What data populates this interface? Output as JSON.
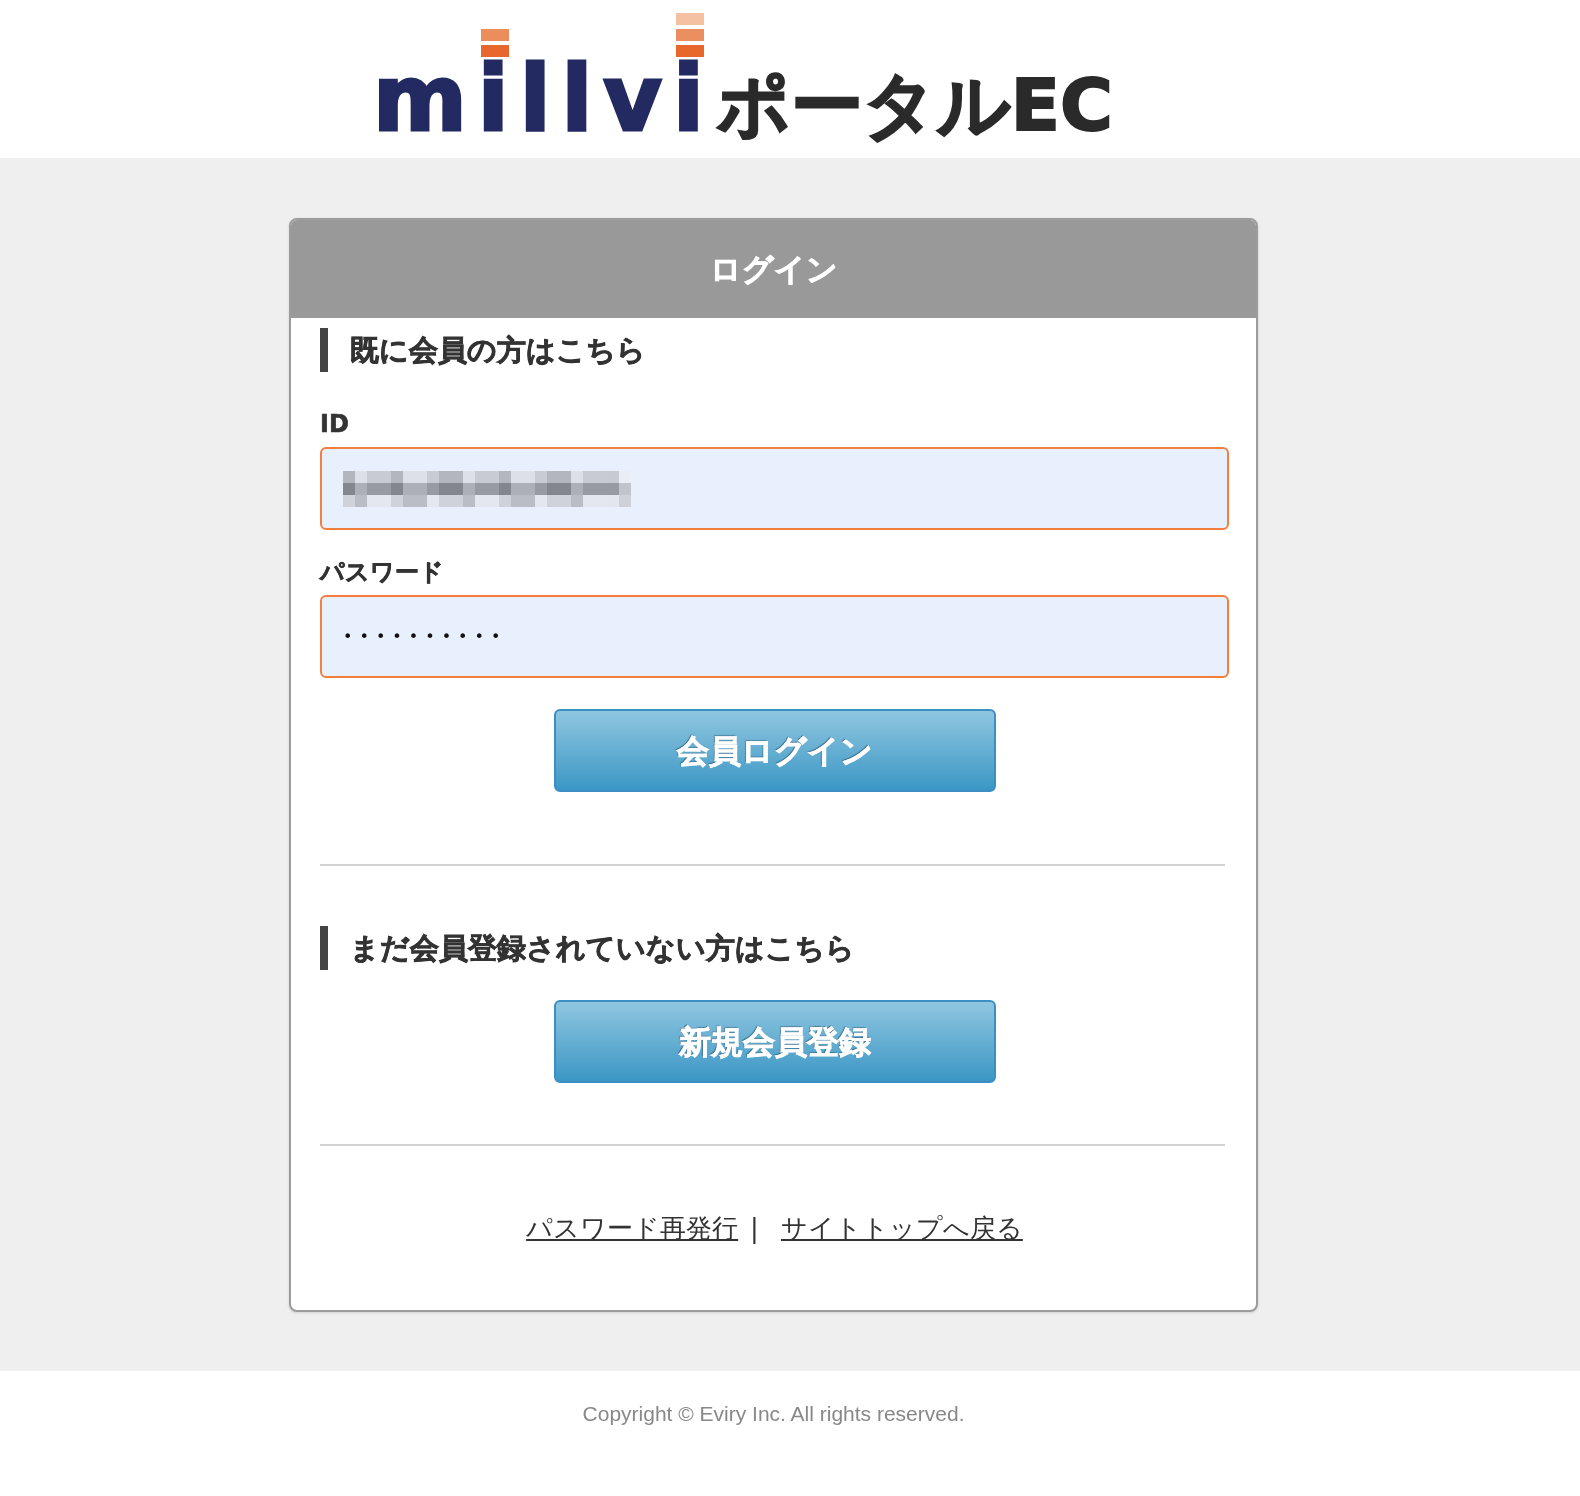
{
  "logo": {
    "brand": "millvi",
    "suffix": "ポータルEC"
  },
  "login_card": {
    "title": "ログイン",
    "member_section": {
      "heading": "既に会員の方はこちら",
      "fields": [
        {
          "kind": "text",
          "label": "ID",
          "redacted": true,
          "autofilled": true
        },
        {
          "kind": "password",
          "label": "パスワード",
          "value": "••••••••••",
          "autofilled": true
        }
      ],
      "button": "会員ログイン"
    },
    "register_section": {
      "heading": "まだ会員登録されていない方はこちら",
      "button": "新規会員登録"
    },
    "links": [
      {
        "label": "パスワード再発行"
      },
      {
        "label": "サイトトップへ戻る"
      }
    ],
    "link_separator": "|"
  },
  "footer": {
    "copyright": "Copyright © Eviry Inc. All rights reserved."
  }
}
